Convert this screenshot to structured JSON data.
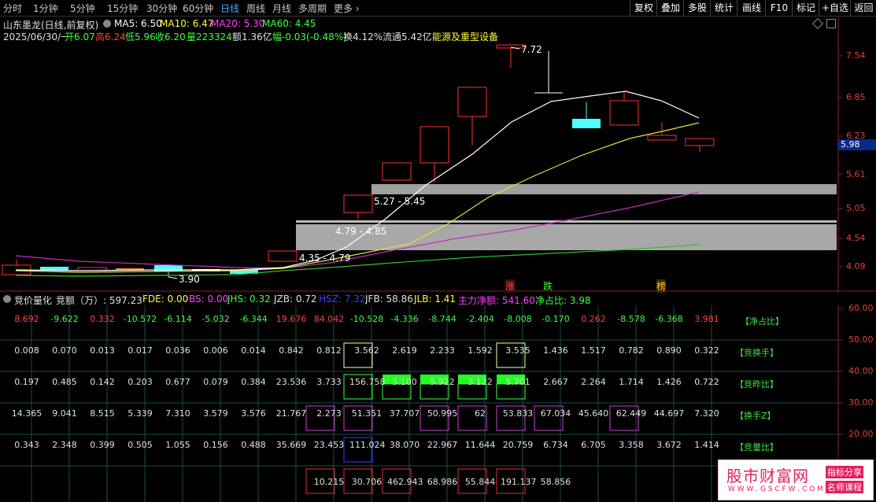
{
  "toolbar": {
    "periods": [
      "分时",
      "1分钟",
      "5分钟",
      "15分钟",
      "30分钟",
      "60分钟",
      "日线",
      "周线",
      "月线",
      "多周期",
      "更多"
    ],
    "active": "日线",
    "right_tools": [
      "复权",
      "叠加",
      "多股",
      "统计",
      "画线",
      "F10",
      "标记",
      "+自选",
      "返回"
    ]
  },
  "info": {
    "stock": "山东墨龙(日线,前复权)",
    "ma5": "MA5: 6.50",
    "ma10": "MA10: 6.47",
    "ma20": "MA20: 5.30",
    "ma60": "MA60: 4.45",
    "date": "2025/06/30/一",
    "open": "开6.07",
    "high": "高6.24",
    "low": "低5.96",
    "close": "收6.20",
    "vol": "量223324",
    "amount": "额1.36亿",
    "change": "幅-0.03(-0.48%)",
    "turnover": "换4.12%",
    "float": "流通5.42亿",
    "sector": "能源及重型设备"
  },
  "price_axis": [
    "7.54",
    "6.85",
    "6.23",
    "5.61",
    "5.05",
    "4.54",
    "4.09"
  ],
  "current_price": "5.98",
  "annotations": {
    "high_label": "7.72",
    "low_label": "3.90",
    "zone1": "5.27 - 5.45",
    "zone2": "4.79 - 4.85",
    "zone3": "4.35 - 4.79",
    "tag_zhang": "涨",
    "tag_die": "跌",
    "tag_bang": "榜"
  },
  "indicator": {
    "name": "竞价量化",
    "unit": "竞额（万）: 597.23",
    "fde": "FDE: 0.00",
    "bs": "BS: 0.00",
    "jhs": "JHS: 0.32",
    "jzb": "JZB: 0.72",
    "hsz": "HSZ: 7.32",
    "jfb": "JFB: 58.86",
    "jlb": "JLB: 1.41",
    "main": "主力净额: 541.60",
    "jzb2": "净占比: 3.98"
  },
  "ind_axis": [
    "60.00",
    "50.00",
    "40.00",
    "30.00",
    "20.00"
  ],
  "rows": {
    "r1": [
      "8.692",
      "-9.622",
      "0.332",
      "-10.572",
      "-6.114",
      "-5.032",
      "-6.344",
      "19.676",
      "84.042",
      "-10.528",
      "-4.336",
      "-8.744",
      "-2.404",
      "-8.008",
      "-0.170",
      "0.262",
      "-8.578",
      "-6.368",
      "3.981"
    ],
    "r2": [
      "0.008",
      "0.070",
      "0.013",
      "0.017",
      "0.036",
      "0.006",
      "0.014",
      "0.842",
      "0.812",
      "3.562",
      "2.619",
      "2.233",
      "1.592",
      "3.535",
      "1.436",
      "1.517",
      "0.782",
      "0.890",
      "0.322"
    ],
    "r3": [
      "0.197",
      "0.485",
      "0.142",
      "0.203",
      "0.677",
      "0.079",
      "0.384",
      "23.536",
      "3.733",
      "156.758",
      "5.100",
      "5.922",
      "3.122",
      "5.701",
      "2.667",
      "2.264",
      "1.714",
      "1.426",
      "0.722"
    ],
    "r4": [
      "14.365",
      "9.041",
      "8.515",
      "5.339",
      "7.310",
      "3.579",
      "3.576",
      "21.767",
      "2.273",
      "51.351",
      "37.707",
      "50.995",
      "62",
      "53.833",
      "67.034",
      "45.640",
      "62.449",
      "44.697",
      "7.320"
    ],
    "r5": [
      "0.343",
      "2.348",
      "0.399",
      "0.505",
      "1.055",
      "0.156",
      "0.488",
      "35.669",
      "23.453",
      "111.024",
      "38.070",
      "22.967",
      "11.644",
      "20.759",
      "6.734",
      "6.705",
      "3.358",
      "3.672",
      "1.414"
    ],
    "r6": [
      "10.215",
      "30.706",
      "462.943",
      "68.986",
      "55.844",
      "191.137",
      "58.856"
    ]
  },
  "row_tags": [
    "【净占比】",
    "【竞换手】",
    "【竞昨比】",
    "【换手Z】",
    "【竞量比】"
  ],
  "watermark": {
    "title": "股市财富网",
    "url": "W W W . G S C F W . C O M",
    "tag1": "指标分享",
    "tag2": "名师课程"
  }
}
